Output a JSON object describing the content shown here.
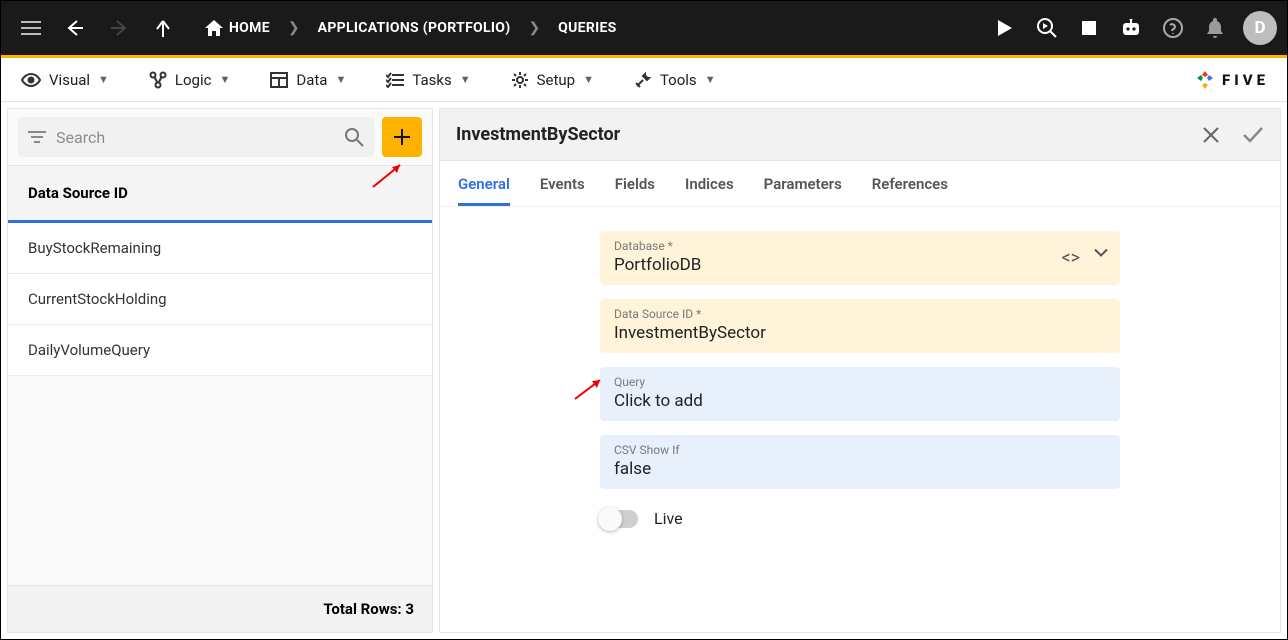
{
  "breadcrumb": {
    "home": "HOME",
    "mid": "APPLICATIONS (PORTFOLIO)",
    "last": "QUERIES"
  },
  "avatar_initial": "D",
  "menubar": {
    "visual": "Visual",
    "logic": "Logic",
    "data": "Data",
    "tasks": "Tasks",
    "setup": "Setup",
    "tools": "Tools"
  },
  "logo_text": "FIVE",
  "left": {
    "search_placeholder": "Search",
    "column_header": "Data Source ID",
    "items": [
      "BuyStockRemaining",
      "CurrentStockHolding",
      "DailyVolumeQuery"
    ],
    "total_label": "Total Rows: 3"
  },
  "detail_title": "InvestmentBySector",
  "tabs": {
    "items": [
      "General",
      "Events",
      "Fields",
      "Indices",
      "Parameters",
      "References"
    ]
  },
  "fields": {
    "database": {
      "label": "Database *",
      "value": "PortfolioDB"
    },
    "dsid": {
      "label": "Data Source ID *",
      "value": "InvestmentBySector"
    },
    "query": {
      "label": "Query",
      "value": "Click to add"
    },
    "csv": {
      "label": "CSV Show If",
      "value": "false"
    },
    "live_label": "Live"
  }
}
